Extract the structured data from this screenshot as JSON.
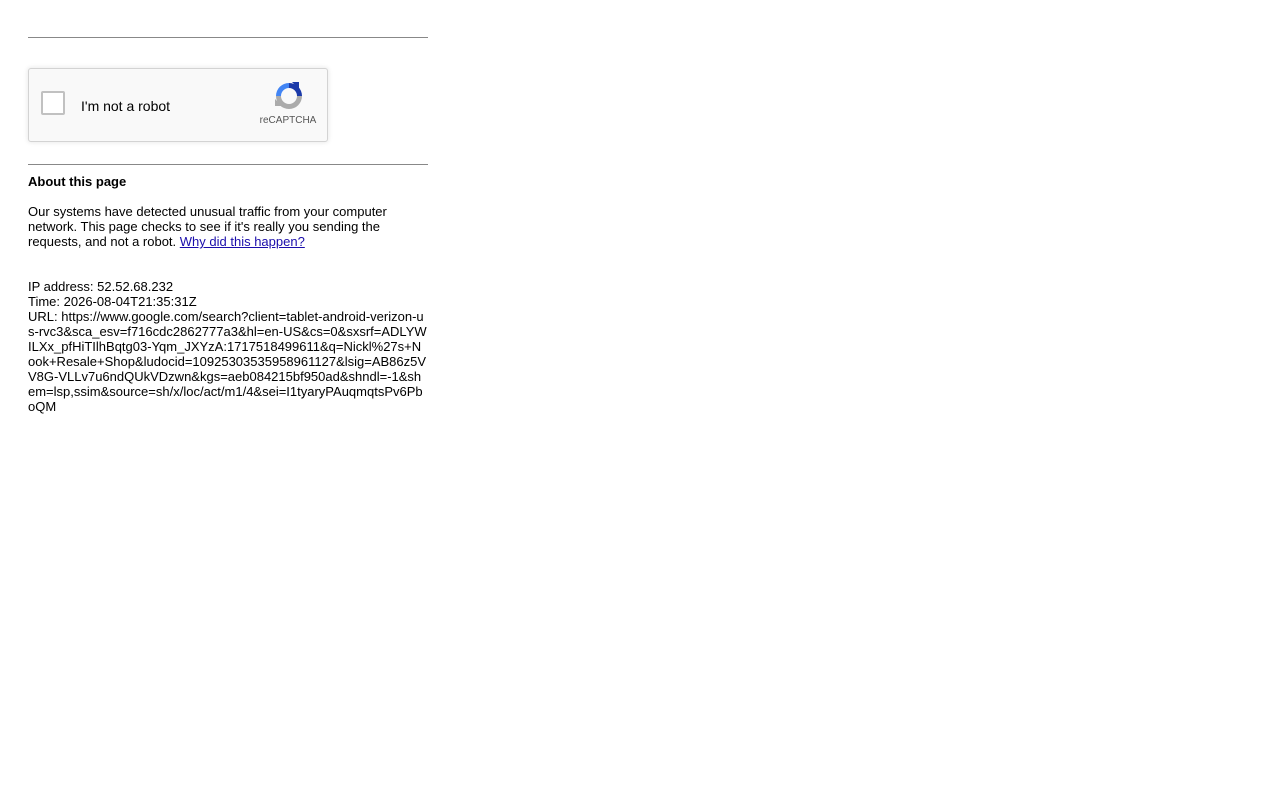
{
  "captcha": {
    "label": "I'm not a robot",
    "brand": "reCAPTCHA",
    "logo_icon": "recaptcha-logo-icon",
    "checked": false
  },
  "about": {
    "title": "About this page",
    "text": "Our systems have detected unusual traffic from your computer network. This page checks to see if it's really you sending the requests, and not a robot.",
    "link_label": "Why did this happen?"
  },
  "info": {
    "ip_label": "IP address:",
    "ip": "52.52.68.232",
    "time_label": "Time:",
    "time": "2026-08-04T21:35:31Z",
    "url_label": "URL:",
    "url": "https://www.google.com/search?client=tablet-android-verizon-us-rvc3&sca_esv=f716cdc2862777a3&hl=en-US&cs=0&sxsrf=ADLYWILXx_pfHiTIlhBqtg03-Yqm_JXYzA:1717518499611&q=Nickl%27s+Nook+Resale+Shop&ludocid=10925303535958961127&lsig=AB86z5VV8G-VLLv7u6ndQUkVDzwn&kgs=aeb084215bf950ad&shndl=-1&shem=lsp,ssim&source=sh/x/loc/act/m1/4&sei=I1tyaryPAuqmqtsPv6PboQM"
  },
  "colors": {
    "link": "#1a0dab",
    "recaptcha_blue": "#1c3aa9",
    "recaptcha_lightblue": "#4285f4",
    "recaptcha_gray": "#ababab"
  }
}
